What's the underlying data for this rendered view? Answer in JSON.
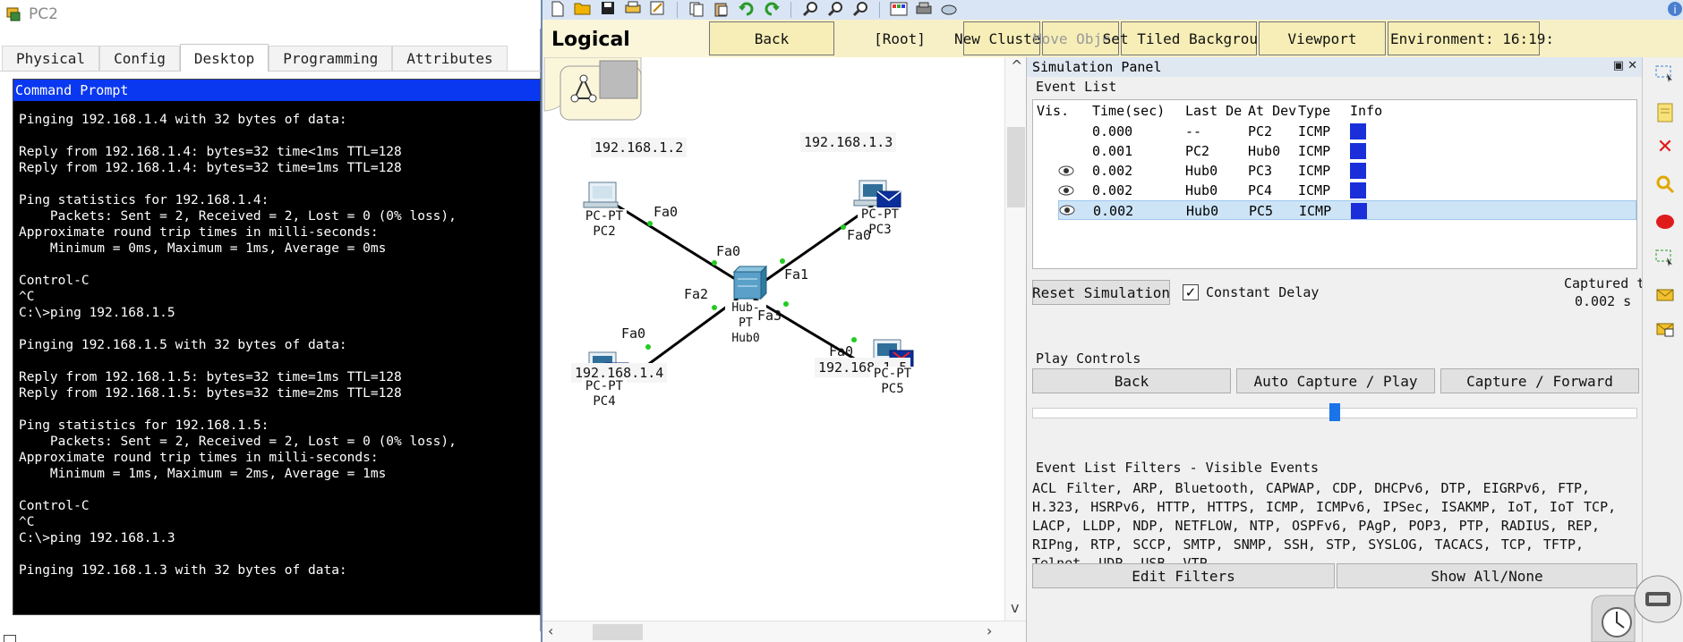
{
  "pc_window": {
    "title": "PC2",
    "tabs": [
      "Physical",
      "Config",
      "Desktop",
      "Programming",
      "Attributes"
    ],
    "active_tab": "Desktop",
    "cmd_title": "Command Prompt",
    "cmd_lines": "Pinging 192.168.1.4 with 32 bytes of data:\n\nReply from 192.168.1.4: bytes=32 time<1ms TTL=128\nReply from 192.168.1.4: bytes=32 time=1ms TTL=128\n\nPing statistics for 192.168.1.4:\n    Packets: Sent = 2, Received = 2, Lost = 0 (0% loss),\nApproximate round trip times in milli-seconds:\n    Minimum = 0ms, Maximum = 1ms, Average = 0ms\n\nControl-C\n^C\nC:\\>ping 192.168.1.5\n\nPinging 192.168.1.5 with 32 bytes of data:\n\nReply from 192.168.1.5: bytes=32 time=1ms TTL=128\nReply from 192.168.1.5: bytes=32 time=2ms TTL=128\n\nPing statistics for 192.168.1.5:\n    Packets: Sent = 2, Received = 2, Lost = 0 (0% loss),\nApproximate round trip times in milli-seconds:\n    Minimum = 1ms, Maximum = 2ms, Average = 1ms\n\nControl-C\n^C\nC:\\>ping 192.168.1.3\n\nPinging 192.168.1.3 with 32 bytes of data:"
  },
  "workspace_bar": {
    "logical_label": "Logical",
    "back": "Back",
    "root": "[Root]",
    "new_cluster": "New Cluster",
    "move_object": "Move Object",
    "set_tiled_background": "Set Tiled Background",
    "viewport": "Viewport",
    "environment": "Environment: 16:19:"
  },
  "topology": {
    "ip_labels": [
      "192.168.1.2",
      "192.168.1.3",
      "192.168.1.4",
      "192.168.1.5"
    ],
    "devices": {
      "pc2": [
        "PC-PT",
        "PC2"
      ],
      "pc3": [
        "PC-PT",
        "PC3"
      ],
      "pc4": [
        "PC-PT",
        "PC4"
      ],
      "pc5": [
        "PC-PT",
        "PC5"
      ],
      "hub": [
        "Hub-PT",
        "Hub0"
      ]
    },
    "ports": [
      "Fa0",
      "Fa0",
      "Fa0",
      "Fa0",
      "Fa0",
      "Fa1",
      "Fa2",
      "Fa3"
    ]
  },
  "simulation_panel": {
    "title": "Simulation Panel",
    "event_list_label": "Event List",
    "columns": [
      "Vis.",
      "Time(sec)",
      "Last De",
      "At Dev",
      "Type",
      "Info"
    ],
    "events": [
      {
        "vis": false,
        "time": "0.000",
        "last": "--",
        "at": "PC2",
        "type": "ICMP"
      },
      {
        "vis": false,
        "time": "0.001",
        "last": "PC2",
        "at": "Hub0",
        "type": "ICMP"
      },
      {
        "vis": true,
        "time": "0.002",
        "last": "Hub0",
        "at": "PC3",
        "type": "ICMP"
      },
      {
        "vis": true,
        "time": "0.002",
        "last": "Hub0",
        "at": "PC4",
        "type": "ICMP"
      },
      {
        "vis": true,
        "time": "0.002",
        "last": "Hub0",
        "at": "PC5",
        "type": "ICMP",
        "selected": true
      }
    ],
    "info_color": "#1a2fd9",
    "reset_simulation": "Reset Simulation",
    "constant_delay": "Constant Delay",
    "constant_delay_checked": true,
    "captured_to_label": "Captured to:",
    "captured_to_value": "0.002 s",
    "play_controls_label": "Play Controls",
    "play_back": "Back",
    "auto_capture": "Auto Capture / Play",
    "capture_forward": "Capture / Forward",
    "filters_label": "Event List Filters - Visible Events",
    "filters_text": "ACL Filter, ARP, Bluetooth, CAPWAP, CDP, DHCPv6, DTP, EIGRPv6, FTP, H.323, HSRPv6, HTTP, HTTPS, ICMP, ICMPv6, IPSec, ISAKMP, IoT, IoT TCP, LACP, LLDP, NDP, NETFLOW, NTP, OSPFv6, PAgP, POP3, PTP, RADIUS, REP, RIPng, RTP, SCCP, SMTP, SNMP, SSH, STP, SYSLOG, TACACS, TCP, TFTP, Telnet, UDP, USB, VTP",
    "edit_filters": "Edit Filters",
    "show_all_none": "Show All/None"
  },
  "colors": {
    "cmd_title_bar": "#0a38f0",
    "toolbar_bg": "#d9e5f4",
    "workspace_bar_bg": "#f7f0c6",
    "link_green": "#22cc22"
  }
}
